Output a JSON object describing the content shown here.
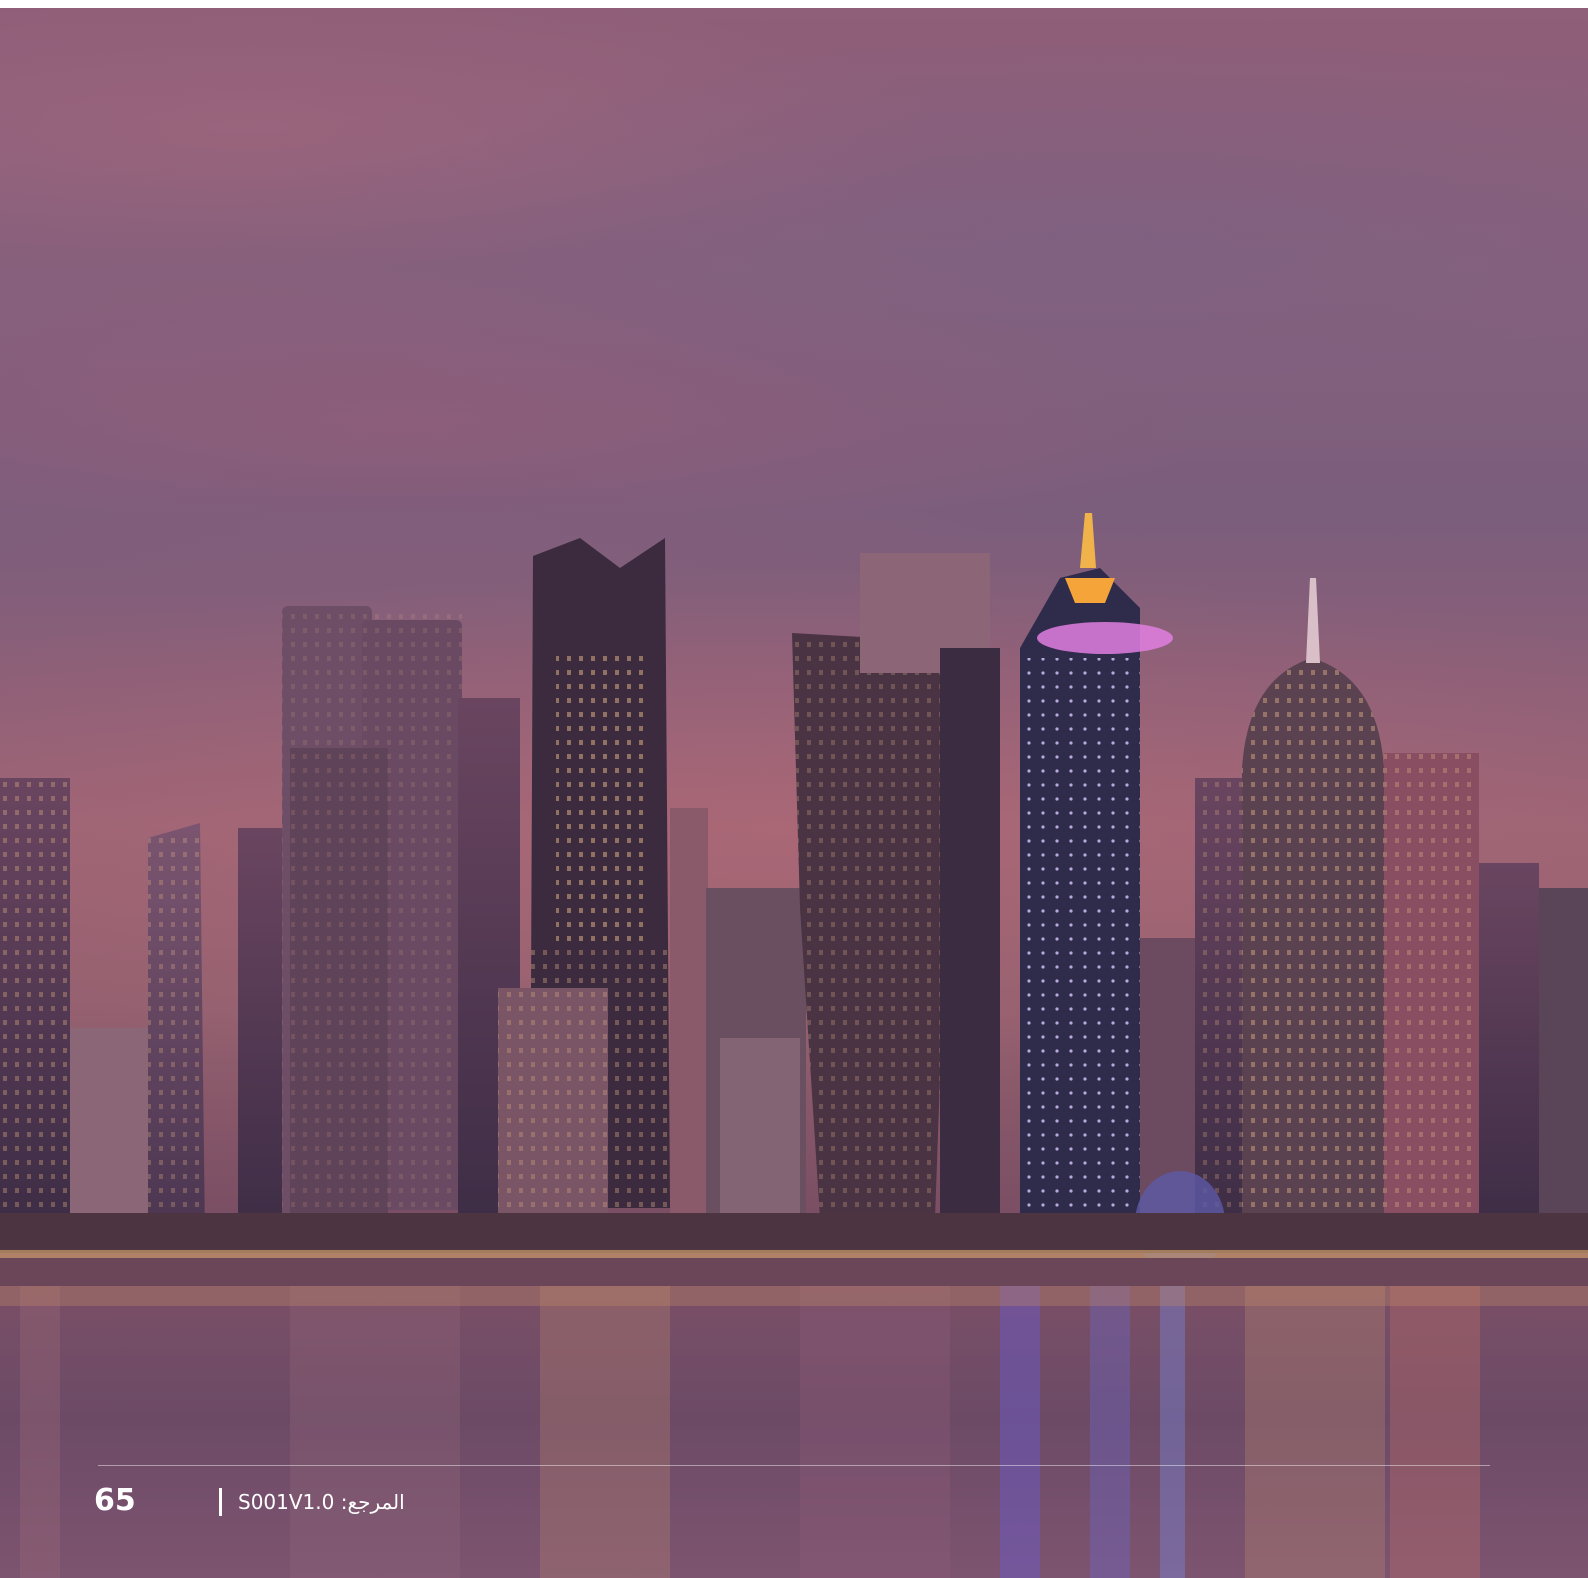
{
  "background_image": {
    "description_icon": "city-skyline-icon"
  },
  "footer": {
    "page_number": "65",
    "reference": "المرجع: S001V1.0"
  },
  "colors": {
    "overlay_tint": "#8b5f78",
    "footer_text": "#ffffff"
  }
}
